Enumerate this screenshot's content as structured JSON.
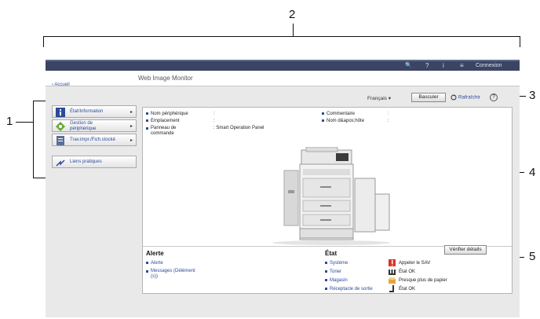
{
  "callouts": {
    "c1": "1",
    "c2": "2",
    "c3": "3",
    "c4": "4",
    "c5": "5"
  },
  "topbar": {
    "search": "🔍",
    "help": "?",
    "info": "i",
    "menu": "≡",
    "login": "Connexion"
  },
  "header": {
    "title": "Web Image Monitor"
  },
  "nav": {
    "back": "‹ Accueil"
  },
  "toolbar": {
    "language": "Français",
    "language_arrow": "▾",
    "switch": "Basculer",
    "refresh": "Rafraîchir",
    "help": "?"
  },
  "sidebar": {
    "items": [
      {
        "label": "État/Information",
        "arrow": "▸",
        "icon": "info-icon"
      },
      {
        "label": "Gestion de\npériphérique",
        "arrow": "▸",
        "icon": "device-management-icon"
      },
      {
        "label": "Trav.impr./Fich.stocké",
        "arrow": "▸",
        "icon": "job-document-icon"
      },
      {
        "label": "Liens pratiques",
        "arrow": "",
        "icon": "links-icon"
      }
    ]
  },
  "device": {
    "name_label": "Nom périphérique",
    "name_sep": ":",
    "location_label": "Emplacement",
    "location_sep": ":",
    "panel_label": "Panneau de\ncommande",
    "panel_value": ": Smart Operation Panel",
    "comment_label": "Commentaire",
    "comment_sep": ":",
    "host_label": "Nom d&apos;hôte",
    "host_sep": ":"
  },
  "alerts": {
    "title": "Alerte",
    "items": [
      "Alerte",
      "Messages (Délément\n(s))"
    ]
  },
  "status": {
    "title": "État",
    "rows": [
      {
        "label": "Système",
        "value": "Appeler le SAV",
        "color": "#d9342b",
        "icon": "call-service-icon"
      },
      {
        "label": "Toner",
        "value": "État OK",
        "color": "#333333",
        "icon": "toner-icon"
      },
      {
        "label": "Magasin",
        "value": "Presque plus de papier",
        "color": "#e8a33a",
        "icon": "paper-tray-icon"
      },
      {
        "label": "Réceptacle de sortie",
        "value": "État OK",
        "color": "#333333",
        "icon": "output-tray-icon"
      }
    ]
  },
  "footer": {
    "check": "Vérifier détails"
  },
  "colors": {
    "accent": "#2a4b9a",
    "topbar": "#3b4563"
  }
}
